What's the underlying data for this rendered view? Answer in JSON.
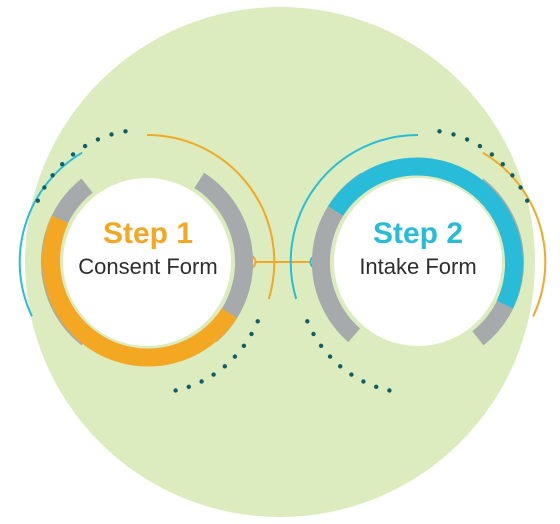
{
  "colors": {
    "background": "#dcecbe",
    "step1_accent": "#f4a722",
    "step2_accent": "#29bcd8",
    "neutral_ring": "#a6aaad",
    "dark_teal": "#0e5e6a",
    "text": "#2d2d2d",
    "white": "#ffffff"
  },
  "steps": [
    {
      "id": "step-1",
      "title": "Step 1",
      "subtitle": "Consent Form",
      "accent": "#f4a722"
    },
    {
      "id": "step-2",
      "title": "Step 2",
      "subtitle": "Intake Form",
      "accent": "#29bcd8"
    }
  ],
  "chart_data": {
    "type": "process-steps",
    "title": "",
    "nodes": [
      {
        "order": 1,
        "label": "Step 1",
        "description": "Consent Form"
      },
      {
        "order": 2,
        "label": "Step 2",
        "description": "Intake Form"
      }
    ],
    "edges": [
      {
        "from": 1,
        "to": 2
      }
    ]
  }
}
